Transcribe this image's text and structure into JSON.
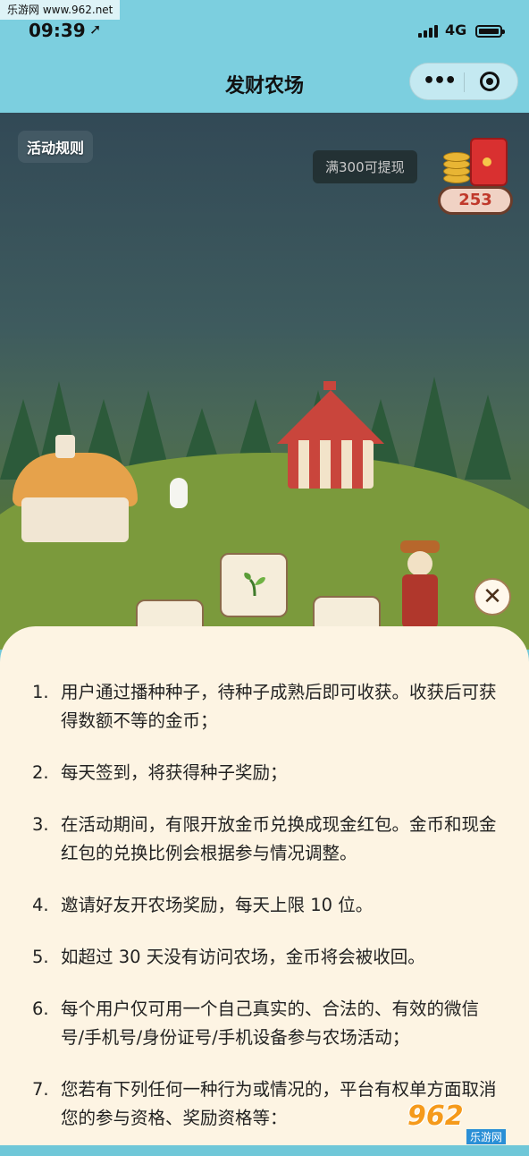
{
  "watermark": "乐游网 www.962.net",
  "status_bar": {
    "time": "09:39",
    "network": "4G"
  },
  "nav": {
    "title": "发财农场"
  },
  "game": {
    "rules_button": "活动规则",
    "withdraw_tip": "满300可提现",
    "coin_count": "253"
  },
  "rules": [
    {
      "num": "1.",
      "text": "用户通过播种种子，待种子成熟后即可收获。收获后可获得数额不等的金币；"
    },
    {
      "num": "2.",
      "text": "每天签到，将获得种子奖励；"
    },
    {
      "num": "3.",
      "text": "在活动期间，有限开放金币兑换成现金红包。金币和现金红包的兑换比例会根据参与情况调整。"
    },
    {
      "num": "4.",
      "text": "邀请好友开农场奖励，每天上限 10 位。"
    },
    {
      "num": "5.",
      "text": "如超过 30 天没有访问农场，金币将会被收回。"
    },
    {
      "num": "6.",
      "text": "每个用户仅可用一个自己真实的、合法的、有效的微信号/手机号/身份证号/手机设备参与农场活动；"
    },
    {
      "num": "7.",
      "text": "您若有下列任何一种行为或情况的，平台有权单方面取消您的参与资格、奖励资格等："
    }
  ],
  "logo": {
    "main": "962",
    "sub": "乐游网"
  },
  "colors": {
    "nav_bg": "#7ccfdf",
    "panel_bg": "#fdf4e3",
    "coin_text": "#c0392b"
  }
}
